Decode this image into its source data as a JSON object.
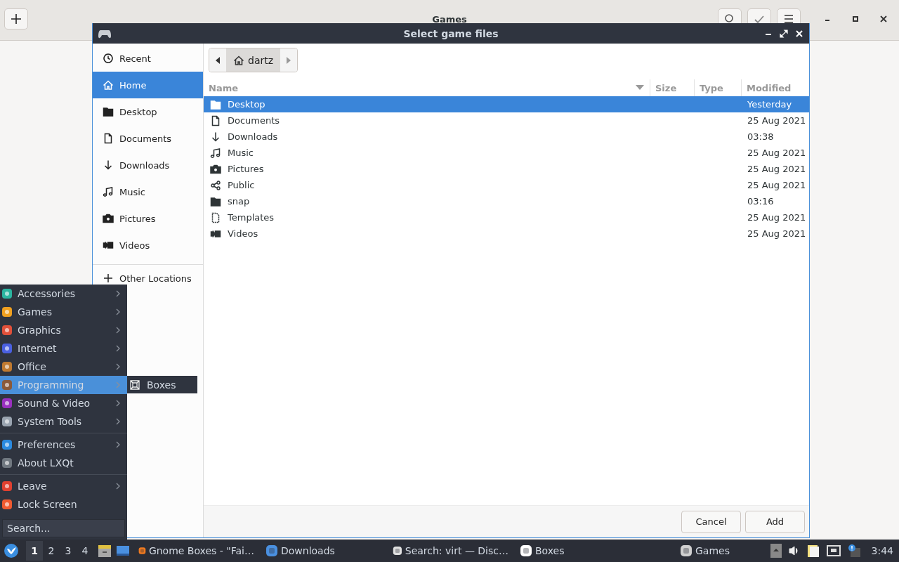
{
  "app": {
    "title": "Games"
  },
  "dialog": {
    "title": "Select game files",
    "sidebar": [
      {
        "label": "Recent",
        "selected": false
      },
      {
        "label": "Home",
        "selected": true
      },
      {
        "label": "Desktop",
        "selected": false
      },
      {
        "label": "Documents",
        "selected": false
      },
      {
        "label": "Downloads",
        "selected": false
      },
      {
        "label": "Music",
        "selected": false
      },
      {
        "label": "Pictures",
        "selected": false
      },
      {
        "label": "Videos",
        "selected": false
      }
    ],
    "other_locations": {
      "label": "Other Locations"
    },
    "path": {
      "label": "dartz"
    },
    "columns": [
      {
        "label": "Name",
        "sorted": true
      },
      {
        "label": "Size",
        "sorted": false
      },
      {
        "label": "Type",
        "sorted": false
      },
      {
        "label": "Modified",
        "sorted": false
      }
    ],
    "rows": [
      {
        "name": "Desktop",
        "modified": "Yesterday",
        "selected": true
      },
      {
        "name": "Documents",
        "modified": "25 Aug 2021",
        "selected": false
      },
      {
        "name": "Downloads",
        "modified": "03:38",
        "selected": false
      },
      {
        "name": "Music",
        "modified": "25 Aug 2021",
        "selected": false
      },
      {
        "name": "Pictures",
        "modified": "25 Aug 2021",
        "selected": false
      },
      {
        "name": "Public",
        "modified": "25 Aug 2021",
        "selected": false
      },
      {
        "name": "snap",
        "modified": "03:16",
        "selected": false
      },
      {
        "name": "Templates",
        "modified": "25 Aug 2021",
        "selected": false
      },
      {
        "name": "Videos",
        "modified": "25 Aug 2021",
        "selected": false
      }
    ],
    "buttons": [
      "Cancel",
      "Add"
    ]
  },
  "menu": {
    "groups": [
      {
        "items": [
          {
            "label": "Accessories",
            "submenu": true,
            "selected": false
          },
          {
            "label": "Games",
            "submenu": true,
            "selected": false
          },
          {
            "label": "Graphics",
            "submenu": true,
            "selected": false
          },
          {
            "label": "Internet",
            "submenu": true,
            "selected": false
          },
          {
            "label": "Office",
            "submenu": true,
            "selected": false
          },
          {
            "label": "Programming",
            "submenu": true,
            "selected": true
          },
          {
            "label": "Sound & Video",
            "submenu": true,
            "selected": false
          },
          {
            "label": "System Tools",
            "submenu": true,
            "selected": false
          }
        ]
      },
      {
        "items": [
          {
            "label": "Preferences",
            "submenu": true,
            "selected": false
          },
          {
            "label": "About LXQt",
            "submenu": false,
            "selected": false
          }
        ]
      },
      {
        "items": [
          {
            "label": "Leave",
            "submenu": true,
            "selected": false
          },
          {
            "label": "Lock Screen",
            "submenu": false,
            "selected": false
          }
        ]
      }
    ],
    "submenu": [
      {
        "label": "Boxes"
      }
    ],
    "search": {
      "placeholder": "Search..."
    }
  },
  "taskbar": {
    "desktops": [
      {
        "label": "1",
        "selected": true
      },
      {
        "label": "2",
        "selected": false
      },
      {
        "label": "3",
        "selected": false
      },
      {
        "label": "4",
        "selected": false
      }
    ],
    "tasks": [
      {
        "label": "Gnome Boxes - \"Fai…"
      },
      {
        "label": "Downloads"
      },
      {
        "label": "Search: virt — Disc…"
      },
      {
        "label": "Boxes"
      },
      {
        "label": "Games"
      }
    ],
    "clock": "3:44"
  }
}
